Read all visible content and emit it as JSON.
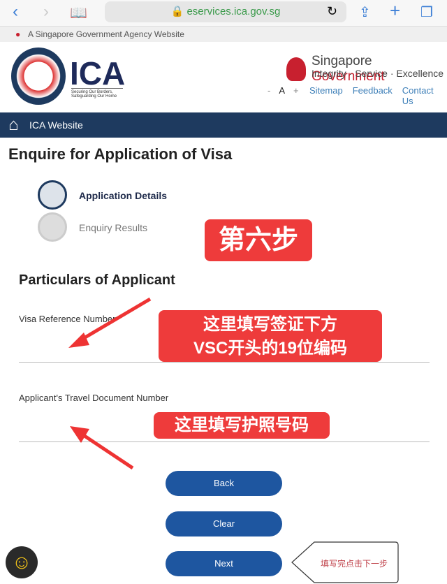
{
  "browser": {
    "url": "eservices.ica.gov.sg"
  },
  "gov_banner": {
    "text": "A Singapore Government Agency Website"
  },
  "header": {
    "logo_text": "ICA",
    "logo_tagline": "Securing Our Borders, Safeguarding Our Home",
    "gov_title_1": "Singapore",
    "gov_title_2": "Government",
    "gov_motto": "Integrity · Service · Excellence",
    "font_minus": "-",
    "font_a": "A",
    "font_plus": "+",
    "links": [
      "Sitemap",
      "Feedback",
      "Contact Us"
    ]
  },
  "navbar": {
    "home_label": "ICA Website"
  },
  "page": {
    "title": "Enquire for Application of Visa",
    "steps": [
      {
        "label": "Application Details",
        "active": true
      },
      {
        "label": "Enquiry Results",
        "active": false
      }
    ],
    "section_title": "Particulars of Applicant",
    "fields": [
      {
        "label": "Visa Reference Number",
        "value": ""
      },
      {
        "label": "Applicant's Travel Document Number",
        "value": ""
      }
    ],
    "buttons": {
      "back": "Back",
      "clear": "Clear",
      "next": "Next"
    }
  },
  "annotations": {
    "step": "第六步",
    "visa_hint_1": "这里填写签证下方",
    "visa_hint_2": "VSC开头的19位编码",
    "passport_hint": "这里填写护照号码",
    "next_hint": "填写完点击下一步"
  },
  "colors": {
    "navbar": "#1e3a5f",
    "button": "#1e56a0",
    "annotation": "#ee3b3b",
    "gov_red": "#c8202f"
  }
}
